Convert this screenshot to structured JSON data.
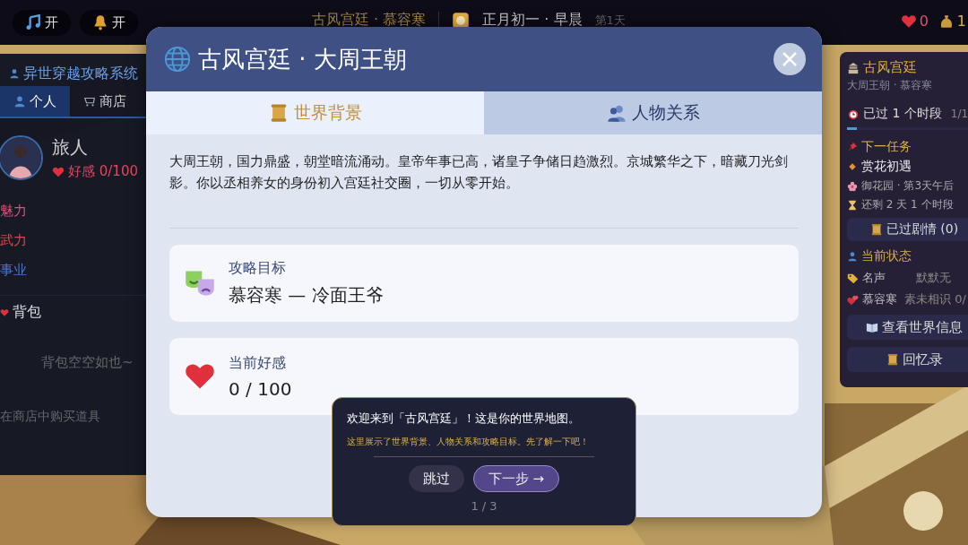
{
  "topbar": {
    "toggles": [
      {
        "kind": "music",
        "label": "开"
      },
      {
        "kind": "bell",
        "label": "开"
      }
    ],
    "world": "古风宫廷 · 慕容寒",
    "date": "正月初一 · 早晨",
    "day": "第1天",
    "hearts": "0",
    "money": "1"
  },
  "left_panel": {
    "title": "异世穿越攻略系统",
    "tabs": [
      {
        "kind": "person",
        "label": "个人",
        "selected": true
      },
      {
        "kind": "cart",
        "label": "商店",
        "selected": false
      }
    ],
    "profile": {
      "name": "旅人",
      "favor": "好感 0/100"
    },
    "stats": [
      {
        "label": "魅力",
        "color": "#e0507a"
      },
      {
        "label": "武力",
        "color": "#e04848"
      },
      {
        "label": "事业",
        "color": "#4a78c8"
      }
    ],
    "bag": {
      "title": "背包",
      "empty": "背包空空如也~",
      "hint": "在商店中购买道具"
    }
  },
  "right_panel": {
    "title": "古风宫廷",
    "subtitle": "大周王朝 · 慕容寒",
    "time": {
      "label": "已过 1 个时段",
      "count": "1/1",
      "level": 0.07
    },
    "task": {
      "heading": "下一任务",
      "name": "赏花初遇",
      "place": "御花园 · 第3天午后",
      "remaining": "还剩 2 天 1 个时段"
    },
    "history_button": "已过剧情 (0)",
    "status": {
      "heading": "当前状态",
      "rows": [
        {
          "kind": "tag",
          "label": "名声",
          "value": "默默无"
        },
        {
          "kind": "heart",
          "label": "慕容寒",
          "value": "素未相识 0/"
        }
      ]
    },
    "buttons": [
      {
        "kind": "book",
        "label": "查看世界信息"
      },
      {
        "kind": "scroll",
        "label": "回忆录"
      }
    ]
  },
  "modal": {
    "title": "古风宫廷 · 大周王朝",
    "tabs": [
      {
        "kind": "scroll",
        "label": "世界背景",
        "selected": true
      },
      {
        "kind": "people",
        "label": "人物关系",
        "selected": false
      }
    ],
    "description": "大周王朝，国力鼎盛，朝堂暗流涌动。皇帝年事已高，诸皇子争储日趋激烈。京城繁华之下，暗藏刀光剑影。你以丞相养女的身份初入宫廷社交圈，一切从零开始。",
    "cards": [
      {
        "kind": "masks",
        "label": "攻略目标",
        "value": "慕容寒 — 冷面王爷"
      },
      {
        "kind": "heart",
        "label": "当前好感",
        "value": "0 / 100"
      }
    ]
  },
  "tutorial": {
    "title": "欢迎来到「古风宫廷」！这是你的世界地图。",
    "body": "这里展示了世界背景、人物关系和攻略目标。先了解一下吧！",
    "buttons": [
      {
        "kind": "secondary",
        "label": "跳过"
      },
      {
        "kind": "primary",
        "label": "下一步 →"
      }
    ],
    "step": "1 / 3"
  }
}
